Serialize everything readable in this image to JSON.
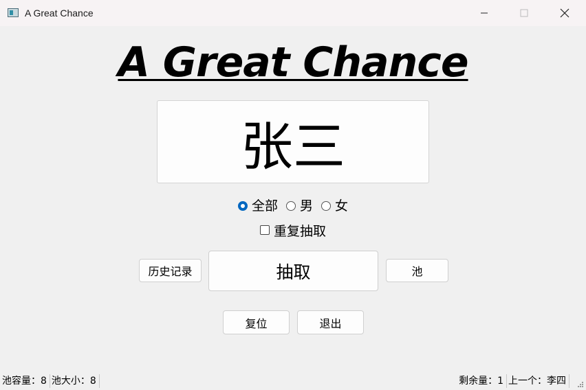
{
  "window": {
    "title": "A Great Chance",
    "minimize_icon": "minimize-icon",
    "maximize_icon": "maximize-icon",
    "close_icon": "close-icon"
  },
  "header": {
    "title": "A Great Chance"
  },
  "display": {
    "name": "张三"
  },
  "filter": {
    "options": [
      {
        "label": "全部",
        "selected": true
      },
      {
        "label": "男",
        "selected": false
      },
      {
        "label": "女",
        "selected": false
      }
    ]
  },
  "repeat_draw": {
    "label": "重复抽取",
    "checked": false
  },
  "buttons": {
    "history": "历史记录",
    "draw": "抽取",
    "pool": "池",
    "reset": "复位",
    "exit": "退出"
  },
  "status": {
    "capacity": "池容量：8",
    "size": "池大小：8",
    "remaining": "剩余量：1",
    "previous": "上一个：李四"
  },
  "colors": {
    "accent": "#0067c0",
    "background": "#f0f0f0"
  }
}
